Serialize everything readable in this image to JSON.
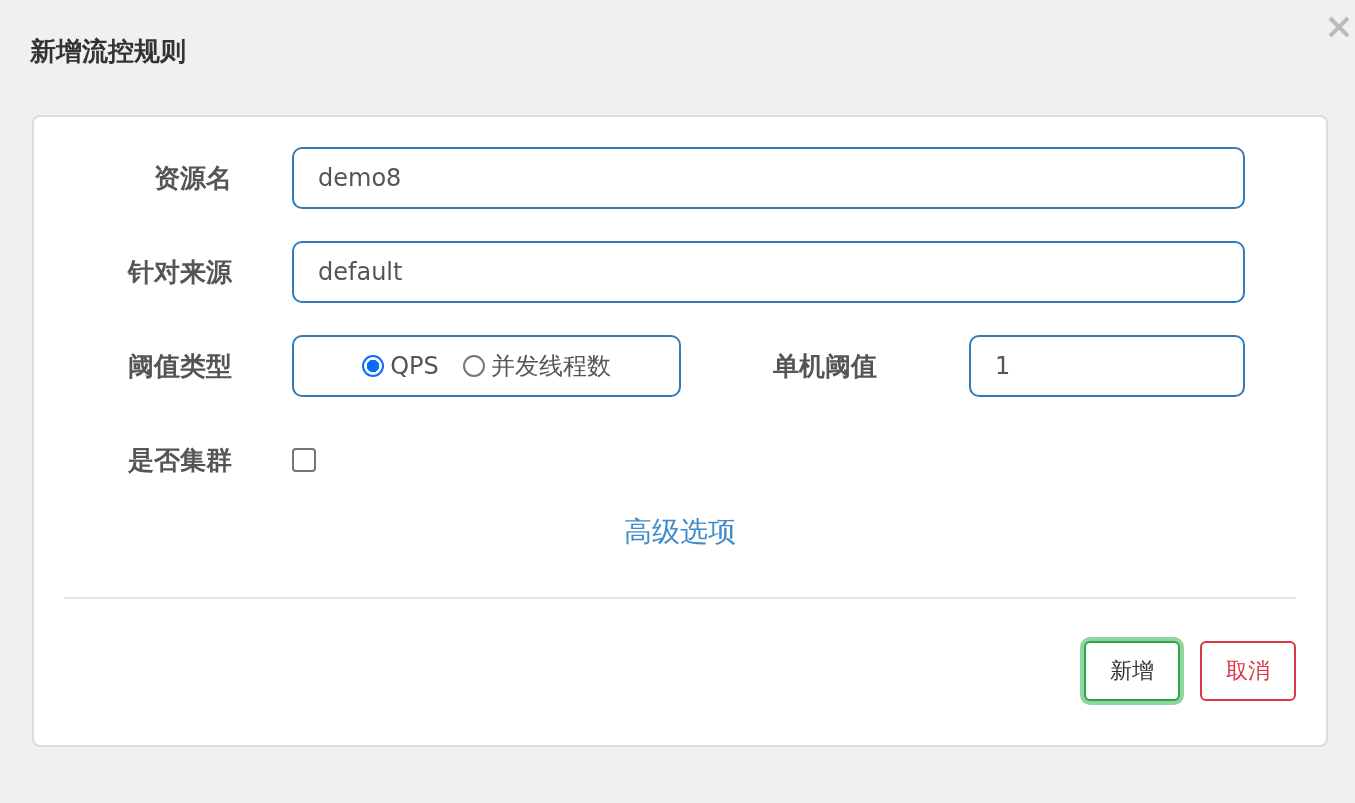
{
  "dialog": {
    "title": "新增流控规则"
  },
  "form": {
    "resource": {
      "label": "资源名",
      "value": "demo8"
    },
    "origin": {
      "label": "针对来源",
      "value": "default"
    },
    "threshold_type": {
      "label": "阈值类型",
      "options": [
        {
          "label": "QPS",
          "selected": true
        },
        {
          "label": "并发线程数",
          "selected": false
        }
      ]
    },
    "threshold": {
      "label": "单机阈值",
      "value": "1"
    },
    "cluster": {
      "label": "是否集群",
      "checked": false
    },
    "advanced_link": "高级选项"
  },
  "buttons": [
    {
      "label": "新增",
      "kind": "primary",
      "focused": true
    },
    {
      "label": "取消",
      "kind": "cancel",
      "focused": false
    }
  ]
}
